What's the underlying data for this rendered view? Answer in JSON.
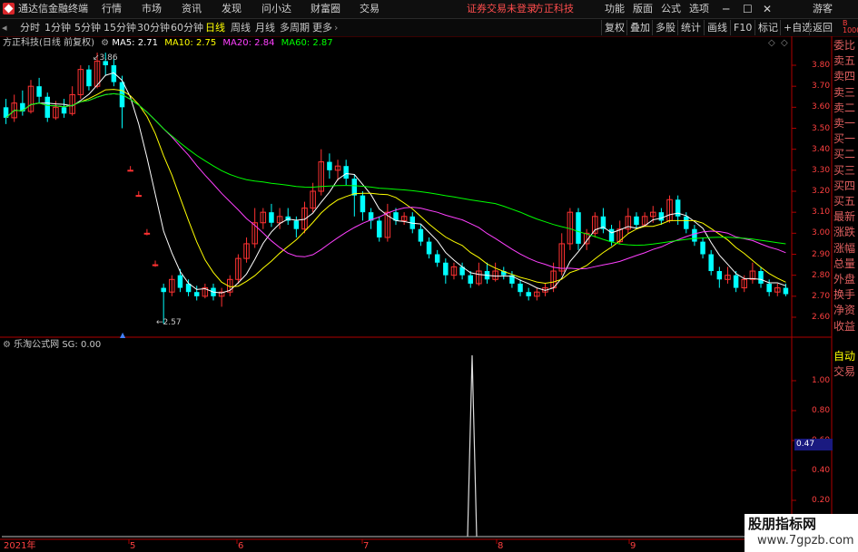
{
  "titlebar": {
    "app_name": "通达信金融终端",
    "menu": [
      "行情",
      "市场",
      "资讯",
      "发现",
      "问小达",
      "财富圈",
      "交易"
    ],
    "status": "证券交易未登录",
    "stock_name": "方正科技",
    "right_menu": [
      "功能",
      "版面",
      "公式",
      "选项"
    ],
    "user": "游客"
  },
  "periods": {
    "items": [
      "分时",
      "1分钟",
      "5分钟",
      "15分钟",
      "30分钟",
      "60分钟",
      "日线",
      "周线",
      "月线",
      "多周期",
      "更多"
    ],
    "selected": "日线",
    "tools": [
      "复权",
      "叠加",
      "多股",
      "统计",
      "画线",
      "F10",
      "标记",
      "+自选",
      "返回"
    ]
  },
  "main_chart": {
    "stock_label": "方正科技(日线 前复权)",
    "ma": [
      {
        "name": "MA5",
        "value": "2.71",
        "color": "#ffffff"
      },
      {
        "name": "MA10",
        "value": "2.75",
        "color": "#ffff00"
      },
      {
        "name": "MA20",
        "value": "2.84",
        "color": "#ff40ff"
      },
      {
        "name": "MA60",
        "value": "2.87",
        "color": "#00ff00"
      }
    ],
    "high_label": "3.86",
    "low_label": "2.57",
    "y_ticks": [
      "3.80",
      "3.70",
      "3.60",
      "3.50",
      "3.40",
      "3.30",
      "3.20",
      "3.10",
      "3.00",
      "2.90",
      "2.80",
      "2.70",
      "2.60"
    ]
  },
  "sub_chart": {
    "label": "乐淘公式网 SG: 0.00",
    "y_ticks": [
      "1.00",
      "0.80",
      "0.60",
      "0.40",
      "0.20"
    ],
    "cursor_value": "0.47"
  },
  "x_axis": {
    "labels": [
      "2021年",
      "5",
      "6",
      "7",
      "8",
      "9"
    ]
  },
  "right_panel": {
    "items": [
      "委比",
      "卖五",
      "卖四",
      "卖三",
      "卖二",
      "卖一",
      "买一",
      "买二",
      "买三",
      "买四",
      "买五",
      "最新",
      "涨跌",
      "涨幅",
      "总量",
      "外盘",
      "换手",
      "净资",
      "收益"
    ],
    "bottom_items": [
      "自动",
      "交易"
    ]
  },
  "watermark": {
    "line1": "股朋指标网",
    "line2": "www.7gpzb.com"
  },
  "chart_data": {
    "type": "candlestick",
    "title": "方正科技(日线 前复权)",
    "ylim": [
      2.55,
      3.9
    ],
    "candles": [
      [
        3.6,
        3.55,
        3.64,
        3.52
      ],
      [
        3.55,
        3.62,
        3.66,
        3.53
      ],
      [
        3.62,
        3.58,
        3.68,
        3.56
      ],
      [
        3.58,
        3.7,
        3.73,
        3.57
      ],
      [
        3.7,
        3.65,
        3.74,
        3.62
      ],
      [
        3.65,
        3.55,
        3.67,
        3.53
      ],
      [
        3.55,
        3.6,
        3.63,
        3.54
      ],
      [
        3.6,
        3.57,
        3.64,
        3.55
      ],
      [
        3.57,
        3.66,
        3.7,
        3.56
      ],
      [
        3.66,
        3.78,
        3.8,
        3.64
      ],
      [
        3.78,
        3.7,
        3.8,
        3.68
      ],
      [
        3.7,
        3.82,
        3.86,
        3.69
      ],
      [
        3.82,
        3.8,
        3.86,
        3.75
      ],
      [
        3.8,
        3.72,
        3.83,
        3.7
      ],
      [
        3.72,
        3.6,
        3.75,
        3.5
      ],
      [
        3.3,
        3.3,
        3.32,
        3.3
      ],
      [
        3.18,
        3.18,
        3.2,
        3.18
      ],
      [
        3.0,
        3.0,
        3.02,
        2.99
      ],
      [
        2.85,
        2.85,
        2.87,
        2.84
      ],
      [
        2.74,
        2.72,
        2.76,
        2.57
      ],
      [
        2.72,
        2.78,
        2.8,
        2.7
      ],
      [
        2.8,
        2.74,
        2.83,
        2.72
      ],
      [
        2.76,
        2.72,
        2.78,
        2.7
      ],
      [
        2.72,
        2.7,
        2.75,
        2.68
      ],
      [
        2.7,
        2.74,
        2.76,
        2.69
      ],
      [
        2.74,
        2.7,
        2.76,
        2.68
      ],
      [
        2.7,
        2.72,
        2.74,
        2.65
      ],
      [
        2.72,
        2.78,
        2.8,
        2.7
      ],
      [
        2.78,
        2.88,
        2.9,
        2.76
      ],
      [
        2.88,
        2.95,
        2.98,
        2.86
      ],
      [
        2.95,
        3.05,
        3.12,
        2.93
      ],
      [
        3.05,
        3.1,
        3.12,
        3.02
      ],
      [
        3.1,
        3.05,
        3.14,
        3.03
      ],
      [
        3.05,
        3.08,
        3.12,
        3.02
      ],
      [
        3.08,
        3.06,
        3.12,
        3.04
      ],
      [
        3.06,
        3.02,
        3.08,
        2.98
      ],
      [
        3.02,
        3.12,
        3.15,
        3.0
      ],
      [
        3.12,
        3.2,
        3.24,
        3.1
      ],
      [
        3.2,
        3.34,
        3.4,
        3.18
      ],
      [
        3.34,
        3.3,
        3.38,
        3.26
      ],
      [
        3.3,
        3.32,
        3.35,
        3.25
      ],
      [
        3.32,
        3.26,
        3.35,
        3.23
      ],
      [
        3.26,
        3.18,
        3.28,
        3.08
      ],
      [
        3.18,
        3.1,
        3.2,
        3.06
      ],
      [
        3.1,
        3.06,
        3.12,
        3.02
      ],
      [
        3.06,
        2.98,
        3.08,
        2.96
      ],
      [
        2.98,
        3.1,
        3.14,
        2.96
      ],
      [
        3.1,
        3.06,
        3.12,
        3.04
      ],
      [
        3.06,
        3.08,
        3.1,
        3.04
      ],
      [
        3.08,
        3.02,
        3.1,
        3.0
      ],
      [
        3.02,
        2.96,
        3.04,
        2.94
      ],
      [
        2.96,
        2.9,
        2.98,
        2.88
      ],
      [
        2.9,
        2.86,
        2.92,
        2.84
      ],
      [
        2.86,
        2.8,
        2.88,
        2.76
      ],
      [
        2.8,
        2.84,
        2.86,
        2.78
      ],
      [
        2.84,
        2.8,
        2.86,
        2.78
      ],
      [
        2.8,
        2.76,
        2.82,
        2.74
      ],
      [
        2.76,
        2.82,
        2.86,
        2.75
      ],
      [
        2.82,
        2.78,
        2.86,
        2.76
      ],
      [
        2.78,
        2.82,
        2.86,
        2.77
      ],
      [
        2.82,
        2.8,
        2.84,
        2.78
      ],
      [
        2.8,
        2.76,
        2.82,
        2.74
      ],
      [
        2.76,
        2.72,
        2.78,
        2.7
      ],
      [
        2.72,
        2.7,
        2.74,
        2.68
      ],
      [
        2.7,
        2.72,
        2.74,
        2.68
      ],
      [
        2.72,
        2.74,
        2.76,
        2.7
      ],
      [
        2.74,
        2.82,
        2.86,
        2.72
      ],
      [
        2.82,
        2.95,
        3.0,
        2.8
      ],
      [
        2.95,
        3.1,
        3.12,
        2.92
      ],
      [
        3.1,
        2.95,
        3.12,
        2.92
      ],
      [
        2.95,
        3.0,
        3.02,
        2.92
      ],
      [
        3.0,
        3.08,
        3.1,
        2.98
      ],
      [
        3.08,
        3.02,
        3.12,
        3.0
      ],
      [
        3.02,
        2.96,
        3.04,
        2.94
      ],
      [
        2.96,
        3.02,
        3.06,
        2.95
      ],
      [
        3.02,
        3.08,
        3.12,
        3.0
      ],
      [
        3.08,
        3.04,
        3.1,
        3.02
      ],
      [
        3.04,
        3.08,
        3.1,
        3.03
      ],
      [
        3.08,
        3.1,
        3.13,
        3.05
      ],
      [
        3.1,
        3.06,
        3.12,
        3.04
      ],
      [
        3.06,
        3.16,
        3.18,
        3.05
      ],
      [
        3.16,
        3.08,
        3.18,
        3.04
      ],
      [
        3.08,
        3.02,
        3.1,
        3.0
      ],
      [
        3.02,
        2.96,
        3.04,
        2.94
      ],
      [
        2.96,
        2.9,
        2.98,
        2.88
      ],
      [
        2.9,
        2.82,
        2.92,
        2.8
      ],
      [
        2.82,
        2.78,
        2.84,
        2.74
      ],
      [
        2.78,
        2.8,
        2.84,
        2.76
      ],
      [
        2.8,
        2.74,
        2.82,
        2.72
      ],
      [
        2.74,
        2.78,
        2.8,
        2.72
      ],
      [
        2.78,
        2.82,
        2.86,
        2.76
      ],
      [
        2.82,
        2.76,
        2.84,
        2.74
      ],
      [
        2.76,
        2.72,
        2.78,
        2.7
      ],
      [
        2.72,
        2.74,
        2.76,
        2.7
      ],
      [
        2.74,
        2.71,
        2.76,
        2.7
      ]
    ],
    "sub_signal": {
      "label": "SG",
      "spike_index": 60,
      "spike_value": 1.0,
      "ylim": [
        0,
        1.05
      ]
    }
  }
}
